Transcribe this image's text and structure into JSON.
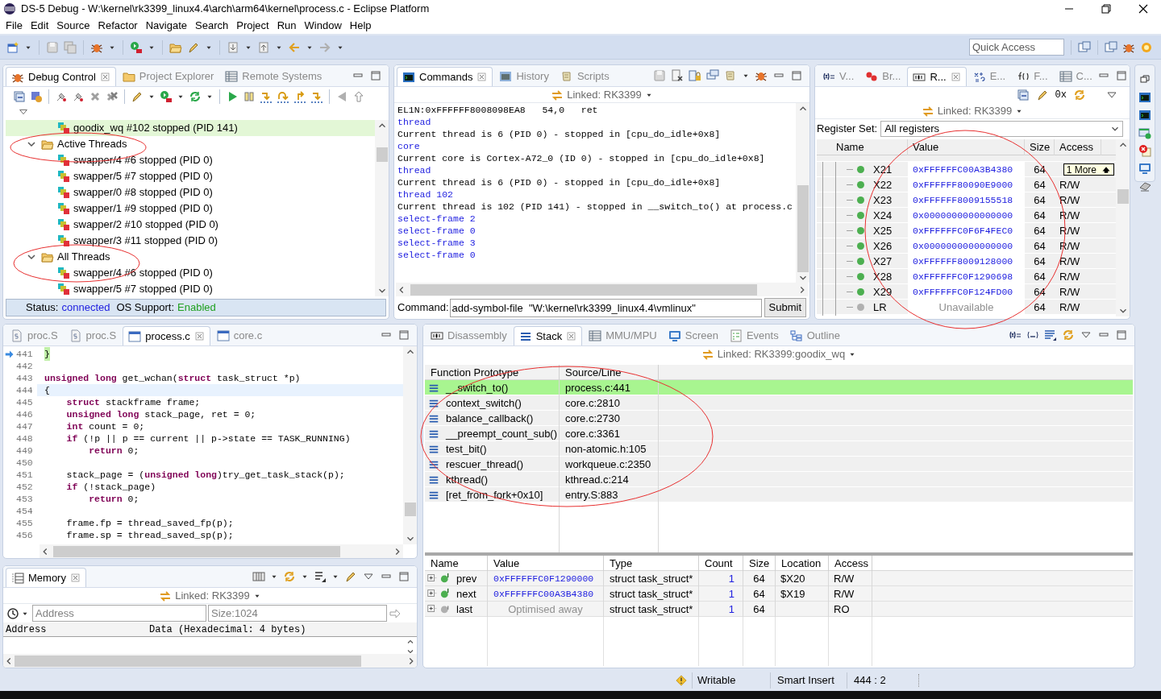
{
  "window": {
    "title": "DS-5 Debug - W:\\kernel\\rk3399_linux4.4\\arch\\arm64\\kernel\\process.c - Eclipse Platform"
  },
  "menu": [
    "File",
    "Edit",
    "Source",
    "Refactor",
    "Navigate",
    "Search",
    "Project",
    "Run",
    "Window",
    "Help"
  ],
  "toolbar": {
    "quick_access": {
      "placeholder": "Quick Access"
    }
  },
  "debug_control": {
    "tabs": [
      {
        "label": "Debug Control",
        "selected": true
      },
      {
        "label": "Project Explorer",
        "selected": false
      },
      {
        "label": "Remote Systems",
        "selected": false
      }
    ],
    "tree": [
      {
        "label": "goodix_wq #102 stopped (PID 141)",
        "kind": "thread",
        "selected": true
      },
      {
        "label": "Active Threads",
        "kind": "folder",
        "expanded": true,
        "selected": false,
        "children": [
          {
            "label": "swapper/4 #6 stopped (PID 0)",
            "kind": "thread",
            "selected": false
          },
          {
            "label": "swapper/5 #7 stopped (PID 0)",
            "kind": "thread",
            "selected": false
          },
          {
            "label": "swapper/0 #8 stopped (PID 0)",
            "kind": "thread",
            "selected": false
          },
          {
            "label": "swapper/1 #9 stopped (PID 0)",
            "kind": "thread",
            "selected": false
          },
          {
            "label": "swapper/2 #10 stopped (PID 0)",
            "kind": "thread",
            "selected": false
          },
          {
            "label": "swapper/3 #11 stopped (PID 0)",
            "kind": "thread",
            "selected": false
          }
        ]
      },
      {
        "label": "All Threads",
        "kind": "folder",
        "expanded": true,
        "selected": false,
        "children": [
          {
            "label": "swapper/4 #6 stopped (PID 0)",
            "kind": "thread",
            "selected": false
          },
          {
            "label": "swapper/5 #7 stopped (PID 0)",
            "kind": "thread",
            "selected": false
          }
        ]
      }
    ],
    "status": {
      "label": "Status:",
      "value": "connected",
      "os_label": "OS Support:",
      "os_value": "Enabled"
    }
  },
  "commands": {
    "tabs": [
      {
        "label": "Commands",
        "selected": true
      },
      {
        "label": "History",
        "selected": false
      },
      {
        "label": "Scripts",
        "selected": false
      }
    ],
    "linked": "Linked: RK3399",
    "log": [
      {
        "text": "EL1N:0xFFFFFF8008098EA8   54,0   ret",
        "kind": "output"
      },
      {
        "text": "thread",
        "kind": "command"
      },
      {
        "text": "Current thread is 6 (PID 0) - stopped in [cpu_do_idle+0x8]",
        "kind": "output"
      },
      {
        "text": "core",
        "kind": "command"
      },
      {
        "text": "Current core is Cortex-A72_0 (ID 0) - stopped in [cpu_do_idle+0x8]",
        "kind": "output"
      },
      {
        "text": "thread",
        "kind": "command"
      },
      {
        "text": "Current thread is 6 (PID 0) - stopped in [cpu_do_idle+0x8]",
        "kind": "output"
      },
      {
        "text": "thread 102",
        "kind": "command"
      },
      {
        "text": "Current thread is 102 (PID 141) - stopped in __switch_to() at process.c",
        "kind": "output"
      },
      {
        "text": "select-frame 2",
        "kind": "command"
      },
      {
        "text": "select-frame 0",
        "kind": "command"
      },
      {
        "text": "select-frame 3",
        "kind": "command"
      },
      {
        "text": "select-frame 0",
        "kind": "command"
      }
    ],
    "command_label": "Command:",
    "command_value": "add-symbol-file  \"W:\\kernel\\rk3399_linux4.4\\vmlinux\"",
    "submit": "Submit"
  },
  "registers": {
    "tabs": [
      {
        "label": "V...",
        "selected": false
      },
      {
        "label": "Br...",
        "selected": false
      },
      {
        "label": "R...",
        "selected": true
      },
      {
        "label": "E...",
        "selected": false
      },
      {
        "label": "F...",
        "selected": false
      },
      {
        "label": "C...",
        "selected": false
      }
    ],
    "hex_toggle": "0x",
    "linked": "Linked: RK3399",
    "register_set_label": "Register Set:",
    "register_set": "All registers",
    "columns": [
      "Name",
      "Value",
      "Size",
      "Access"
    ],
    "rows": [
      {
        "name": "X21",
        "value": "0xFFFFFFC00A3B4380",
        "size": "64",
        "available": true
      },
      {
        "name": "X22",
        "value": "0xFFFFFF80090E9000",
        "size": "64",
        "access": "R/W",
        "available": true
      },
      {
        "name": "X23",
        "value": "0xFFFFFF8009155518",
        "size": "64",
        "access": "R/W",
        "available": true
      },
      {
        "name": "X24",
        "value": "0x0000000000000000",
        "size": "64",
        "access": "R/W",
        "available": true
      },
      {
        "name": "X25",
        "value": "0xFFFFFFC0F6F4FEC0",
        "size": "64",
        "access": "R/W",
        "available": true
      },
      {
        "name": "X26",
        "value": "0x0000000000000000",
        "size": "64",
        "access": "R/W",
        "available": true
      },
      {
        "name": "X27",
        "value": "0xFFFFFF8009128000",
        "size": "64",
        "access": "R/W",
        "available": true
      },
      {
        "name": "X28",
        "value": "0xFFFFFFC0F1290698",
        "size": "64",
        "access": "R/W",
        "available": true
      },
      {
        "name": "X29",
        "value": "0xFFFFFFC0F124FD00",
        "size": "64",
        "access": "R/W",
        "available": true
      },
      {
        "name": "LR",
        "value": "Unavailable",
        "size": "64",
        "access": "R/W",
        "available": false
      }
    ],
    "tooltip": "1 More"
  },
  "editor": {
    "tabs": [
      {
        "label": "proc.S",
        "kind": "assembly",
        "selected": false
      },
      {
        "label": "proc.S",
        "kind": "assembly",
        "selected": false
      },
      {
        "label": "process.c",
        "kind": "c",
        "selected": true
      },
      {
        "label": "core.c",
        "kind": "c",
        "selected": false
      }
    ],
    "lines": [
      {
        "number": "441",
        "current": true,
        "cursor": false,
        "code": [
          {
            "text": "}",
            "kind": "plain"
          }
        ]
      },
      {
        "number": "442",
        "current": false,
        "cursor": false
      },
      {
        "number": "443",
        "current": false,
        "cursor": false,
        "code": [
          {
            "text": "unsigned long",
            "kind": "keyword"
          },
          {
            "text": " get_wchan(",
            "kind": "plain"
          },
          {
            "text": "struct",
            "kind": "keyword"
          },
          {
            "text": " task_struct *p)",
            "kind": "plain"
          }
        ]
      },
      {
        "number": "444",
        "current": false,
        "cursor": true,
        "code": [
          {
            "text": "{",
            "kind": "plain"
          }
        ]
      },
      {
        "number": "445",
        "current": false,
        "cursor": false,
        "code": [
          {
            "text": "    struct",
            "kind": "keyword"
          },
          {
            "text": " stackframe frame;",
            "kind": "plain"
          }
        ]
      },
      {
        "number": "446",
        "current": false,
        "cursor": false,
        "code": [
          {
            "text": "    unsigned long",
            "kind": "keyword"
          },
          {
            "text": " stack_page, ret = 0;",
            "kind": "plain"
          }
        ]
      },
      {
        "number": "447",
        "current": false,
        "cursor": false,
        "code": [
          {
            "text": "    int",
            "kind": "keyword"
          },
          {
            "text": " count = 0;",
            "kind": "plain"
          }
        ]
      },
      {
        "number": "448",
        "current": false,
        "cursor": false,
        "code": [
          {
            "text": "    if",
            "kind": "keyword"
          },
          {
            "text": " (!p || p == current || p->state == TASK_RUNNING)",
            "kind": "plain"
          }
        ]
      },
      {
        "number": "449",
        "current": false,
        "cursor": false,
        "code": [
          {
            "text": "        return",
            "kind": "keyword"
          },
          {
            "text": " 0;",
            "kind": "plain"
          }
        ]
      },
      {
        "number": "450",
        "current": false,
        "cursor": false
      },
      {
        "number": "451",
        "current": false,
        "cursor": false,
        "code": [
          {
            "text": "    stack_page = (",
            "kind": "plain"
          },
          {
            "text": "unsigned long",
            "kind": "keyword"
          },
          {
            "text": ")try_get_task_stack(p);",
            "kind": "plain"
          }
        ]
      },
      {
        "number": "452",
        "current": false,
        "cursor": false,
        "code": [
          {
            "text": "    if",
            "kind": "keyword"
          },
          {
            "text": " (!stack_page)",
            "kind": "plain"
          }
        ]
      },
      {
        "number": "453",
        "current": false,
        "cursor": false,
        "code": [
          {
            "text": "        return",
            "kind": "keyword"
          },
          {
            "text": " 0;",
            "kind": "plain"
          }
        ]
      },
      {
        "number": "454",
        "current": false,
        "cursor": false
      },
      {
        "number": "455",
        "current": false,
        "cursor": false,
        "code": [
          {
            "text": "    frame.fp = thread_saved_fp(p);",
            "kind": "plain"
          }
        ]
      },
      {
        "number": "456",
        "current": false,
        "cursor": false,
        "code": [
          {
            "text": "    frame.sp = thread_saved_sp(p);",
            "kind": "plain"
          }
        ]
      }
    ]
  },
  "memory": {
    "tab": "Memory",
    "linked": "Linked: RK3399",
    "address": {
      "placeholder": "Address"
    },
    "size": {
      "placeholder": "Size:1024"
    },
    "columns": [
      "Address",
      "Data (Hexadecimal: 4 bytes)"
    ]
  },
  "stack": {
    "tabs": [
      {
        "label": "Disassembly",
        "selected": false
      },
      {
        "label": "Stack",
        "selected": true
      },
      {
        "label": "MMU/MPU",
        "selected": false
      },
      {
        "label": "Screen",
        "selected": false
      },
      {
        "label": "Events",
        "selected": false
      },
      {
        "label": "Outline",
        "selected": false
      }
    ],
    "linked": "Linked: RK3399:goodix_wq",
    "columns": [
      "Function Prototype",
      "Source/Line"
    ],
    "frames": [
      {
        "function": "__switch_to()",
        "source": "process.c:441",
        "selected": true
      },
      {
        "function": "context_switch()",
        "source": "core.c:2810",
        "selected": false
      },
      {
        "function": "balance_callback()",
        "source": "core.c:2730",
        "selected": false
      },
      {
        "function": "__preempt_count_sub()",
        "source": "core.c:3361",
        "selected": false
      },
      {
        "function": "test_bit()",
        "source": "non-atomic.h:105",
        "selected": false
      },
      {
        "function": "rescuer_thread()",
        "source": "workqueue.c:2350",
        "selected": false
      },
      {
        "function": "kthread()",
        "source": "kthread.c:214",
        "selected": false
      },
      {
        "function": "[ret_from_fork+0x10]",
        "source": "entry.S:883",
        "selected": false
      }
    ]
  },
  "variables": {
    "columns": [
      "Name",
      "Value",
      "Type",
      "Count",
      "Size",
      "Location",
      "Access"
    ],
    "rows": [
      {
        "name": "prev",
        "value": "0xFFFFFFC0F1290000",
        "type": "struct task_struct*",
        "count": "1",
        "size": "64",
        "location": "$X20",
        "access": "R/W",
        "available": true
      },
      {
        "name": "next",
        "value": "0xFFFFFFC00A3B4380",
        "type": "struct task_struct*",
        "count": "1",
        "size": "64",
        "location": "$X19",
        "access": "R/W",
        "available": true
      },
      {
        "name": "last",
        "value": "Optimised away",
        "type": "struct task_struct*",
        "count": "1",
        "size": "64",
        "access": "RO",
        "available": false
      }
    ]
  },
  "status_bar": [
    "Writable",
    "Smart Insert",
    "444 : 2"
  ]
}
